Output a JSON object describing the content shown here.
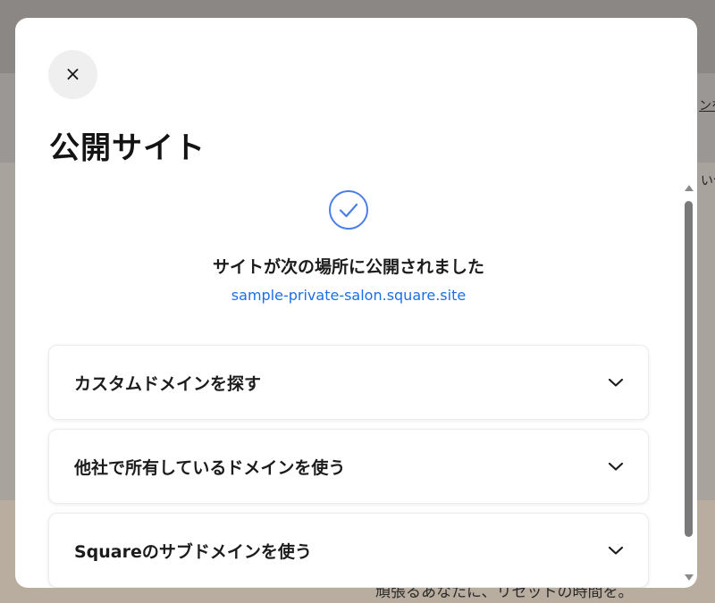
{
  "background": {
    "right_link_fragment": "ンを",
    "right_text_fragment": "い合",
    "bottom_text_fragment": "頑張るあなたに、リセットの時間を。"
  },
  "modal": {
    "close_label": "×",
    "title": "公開サイト",
    "success_icon": "check-circle-icon",
    "success_message": "サイトが次の場所に公開されました",
    "site_url": "sample-private-salon.square.site",
    "accordions": [
      {
        "label": "カスタムドメインを探す",
        "icon": "chevron-down-icon"
      },
      {
        "label": "他社で所有しているドメインを使う",
        "icon": "chevron-down-icon"
      },
      {
        "label": "Squareのサブドメインを使う",
        "icon": "chevron-down-icon"
      }
    ]
  },
  "colors": {
    "accent": "#1a6fe8",
    "check_icon": "#4a7ee8",
    "overlay": "#7d7a76"
  }
}
